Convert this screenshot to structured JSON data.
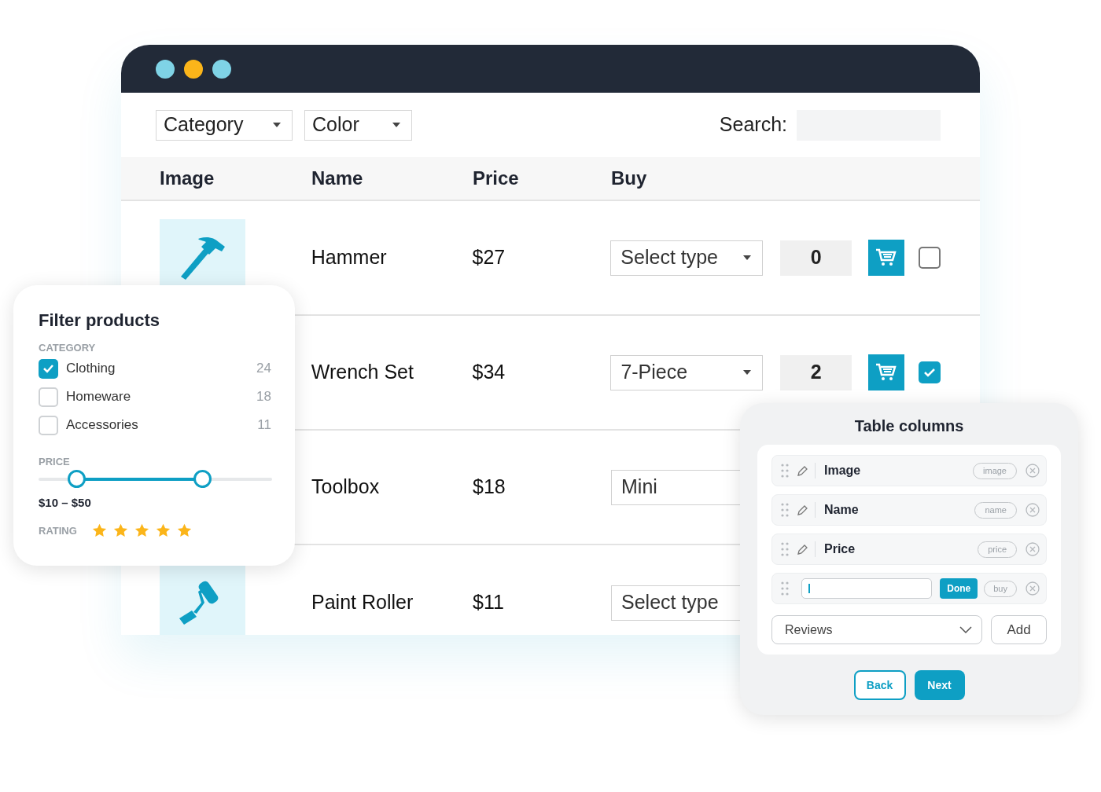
{
  "toolbar": {
    "filters": [
      {
        "label": "Category"
      },
      {
        "label": "Color"
      }
    ],
    "search": {
      "label": "Search:"
    }
  },
  "table": {
    "columns": [
      "Image",
      "Name",
      "Price",
      "Buy"
    ],
    "rows": [
      {
        "kind": "hammer",
        "name": "Hammer",
        "price": "$27",
        "type": "Select type",
        "quantity": "0",
        "checked": false
      },
      {
        "name": "Wrench Set",
        "price": "$34",
        "type": "7-Piece",
        "quantity": "2",
        "checked": true
      },
      {
        "name": "Toolbox",
        "price": "$18",
        "type": "Mini"
      },
      {
        "kind": "roller",
        "name": "Paint Roller",
        "price": "$11",
        "type": "Select type"
      }
    ]
  },
  "filter_panel": {
    "title": "Filter products",
    "category_label": "CATEGORY",
    "categories": [
      {
        "label": "Clothing",
        "count": "24",
        "checked": true
      },
      {
        "label": "Homeware",
        "count": "18",
        "checked": false
      },
      {
        "label": "Accessories",
        "count": "11",
        "checked": false
      }
    ],
    "price_label": "PRICE",
    "price_thumbs": [
      {
        "level": 0.16
      },
      {
        "level": 0.7
      }
    ],
    "price_text": "$10 – $50",
    "rating_label": "RATING",
    "stars": 5
  },
  "columns_panel": {
    "title": "Table columns",
    "columns": [
      {
        "kind": "label",
        "label": "Image",
        "key": "image"
      },
      {
        "kind": "label",
        "label": "Name",
        "key": "name"
      },
      {
        "kind": "label",
        "label": "Price",
        "key": "price"
      },
      {
        "kind": "editing",
        "button": "Done",
        "key": "buy"
      }
    ],
    "add_select": "Reviews",
    "add_button": "Add",
    "back_button": "Back",
    "next_button": "Next"
  }
}
